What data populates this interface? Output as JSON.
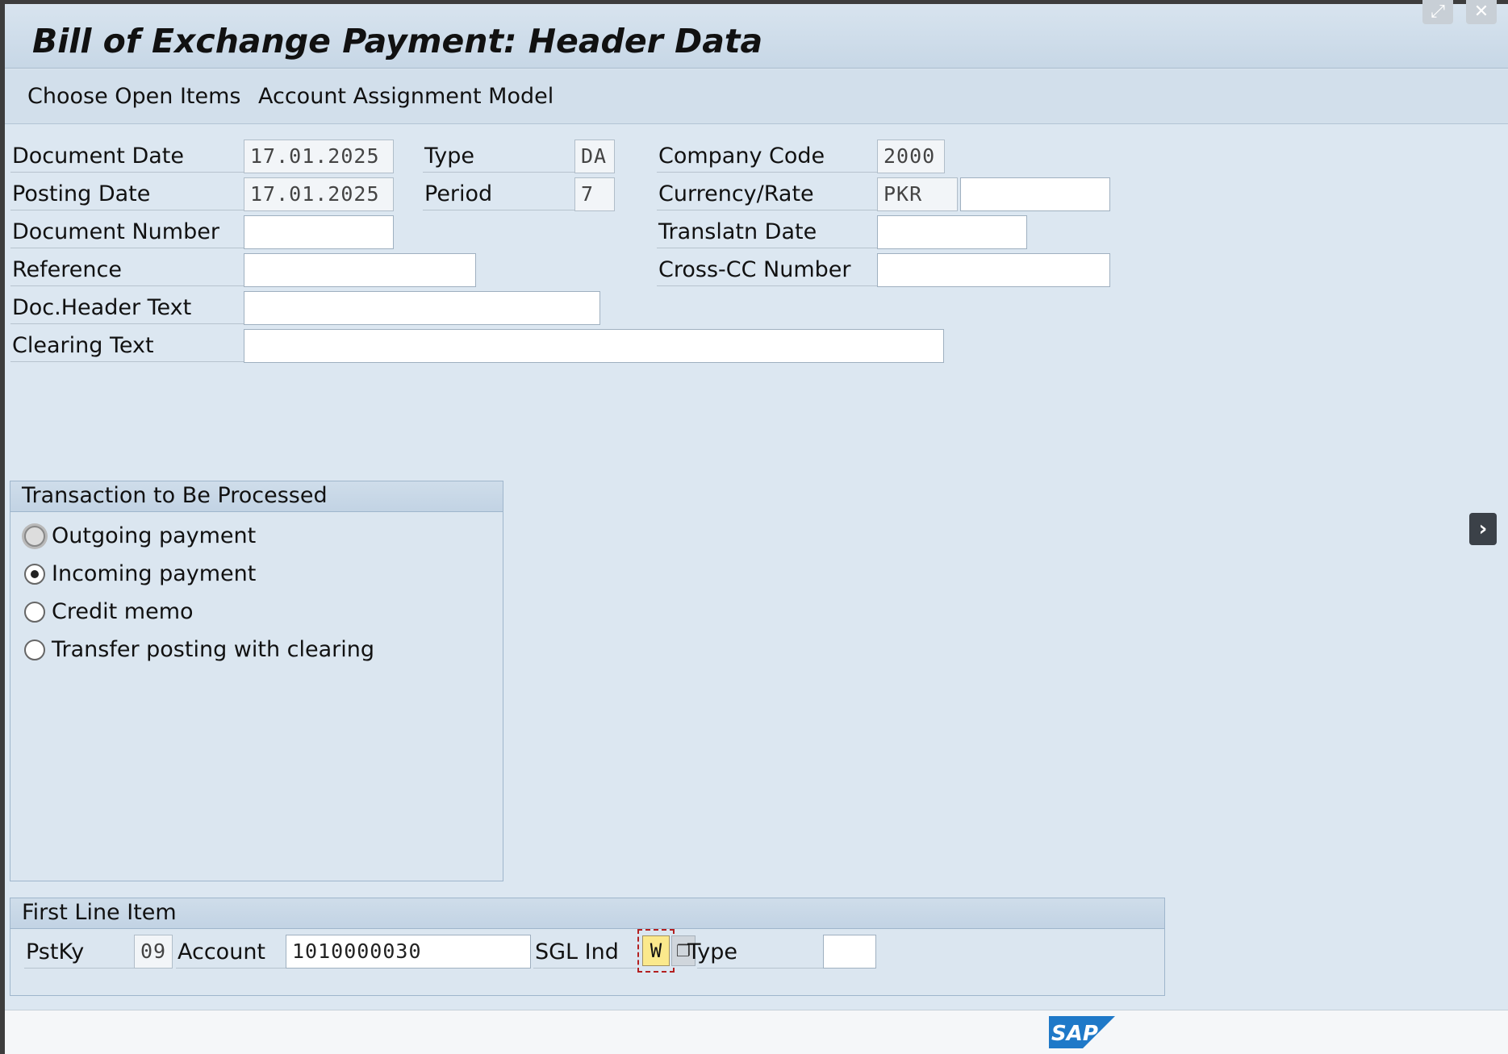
{
  "window": {
    "title": "Bill of Exchange Payment: Header Data",
    "maximize_icon": "expand-icon",
    "close_icon": "close-icon"
  },
  "toolbar": {
    "choose_open_items": "Choose Open Items",
    "account_assignment_model": "Account Assignment Model"
  },
  "header": {
    "document_date": {
      "label": "Document Date",
      "value": "17.01.2025"
    },
    "type": {
      "label": "Type",
      "value": "DA"
    },
    "company_code": {
      "label": "Company Code",
      "value": "2000"
    },
    "posting_date": {
      "label": "Posting Date",
      "value": "17.01.2025"
    },
    "period": {
      "label": "Period",
      "value": "7"
    },
    "currency_rate": {
      "label": "Currency/Rate",
      "currency": "PKR",
      "rate": ""
    },
    "document_number": {
      "label": "Document Number",
      "value": ""
    },
    "translatn_date": {
      "label": "Translatn Date",
      "value": ""
    },
    "reference": {
      "label": "Reference",
      "value": ""
    },
    "cross_cc_number": {
      "label": "Cross-CC Number",
      "value": ""
    },
    "doc_header_text": {
      "label": "Doc.Header Text",
      "value": ""
    },
    "clearing_text": {
      "label": "Clearing Text",
      "value": ""
    }
  },
  "transaction": {
    "title": "Transaction to Be Processed",
    "options": [
      {
        "label": "Outgoing payment",
        "selected": false
      },
      {
        "label": "Incoming payment",
        "selected": true
      },
      {
        "label": "Credit memo",
        "selected": false
      },
      {
        "label": "Transfer posting with clearing",
        "selected": false
      }
    ]
  },
  "first_line_item": {
    "title": "First Line Item",
    "pstky_label": "PstKy",
    "pstky_value": "09",
    "account_label": "Account",
    "account_value": "1010000030",
    "sgl_ind_label": "SGL Ind",
    "sgl_ind_value": "W",
    "type_label": "Type",
    "type_value": ""
  },
  "status": {
    "logo_text": "SAP"
  },
  "colors": {
    "background": "#dce7f1",
    "sap_logo": "#1f79c8",
    "focus_border": "#b32020",
    "sgl_highlight": "#fbe98c"
  }
}
